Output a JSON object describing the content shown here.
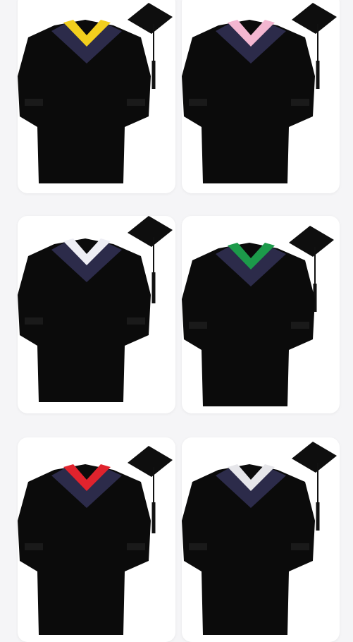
{
  "products": [
    {
      "id": "gown-yellow",
      "accent": "#f2cf1d",
      "hood": "#2c2b4a"
    },
    {
      "id": "gown-pink",
      "accent": "#f3b6d0",
      "hood": "#2c2b4a"
    },
    {
      "id": "gown-white",
      "accent": "#eeeef4",
      "hood": "#2c2b4a"
    },
    {
      "id": "gown-green",
      "accent": "#1c9a4a",
      "hood": "#2c2b4a"
    },
    {
      "id": "gown-red",
      "accent": "#e0232d",
      "hood": "#2c2b4a"
    },
    {
      "id": "gown-silver",
      "accent": "#e6e6ea",
      "hood": "#2c2b4a"
    }
  ]
}
